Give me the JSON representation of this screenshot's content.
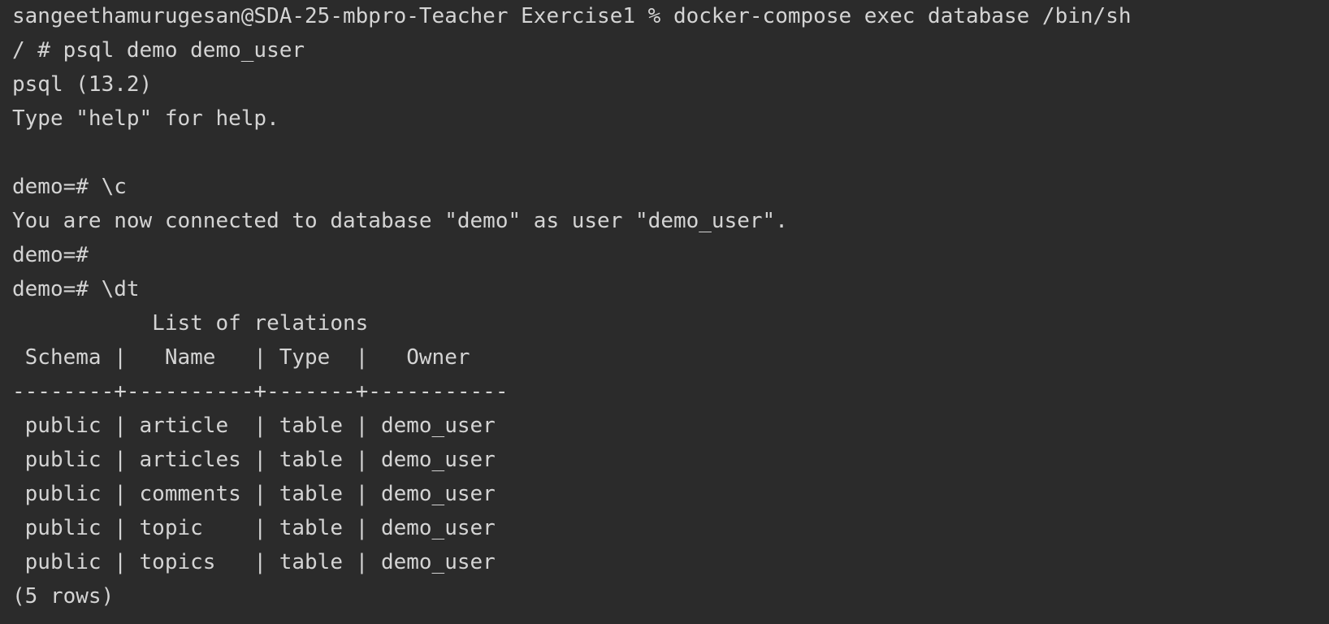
{
  "terminal": {
    "lines": [
      "sangeethamurugesan@SDA-25-mbpro-Teacher Exercise1 % docker-compose exec database /bin/sh",
      "/ # psql demo demo_user",
      "psql (13.2)",
      "Type \"help\" for help.",
      "",
      "demo=# \\c",
      "You are now connected to database \"demo\" as user \"demo_user\".",
      "demo=#",
      "demo=# \\dt",
      "           List of relations",
      " Schema |   Name   | Type  |   Owner",
      "--------+----------+-------+-----------",
      " public | article  | table | demo_user",
      " public | articles | table | demo_user",
      " public | comments | table | demo_user",
      " public | topic    | table | demo_user",
      " public | topics   | table | demo_user",
      "(5 rows)"
    ]
  },
  "colors": {
    "background": "#2b2b2b",
    "text": "#d4d4d4"
  }
}
